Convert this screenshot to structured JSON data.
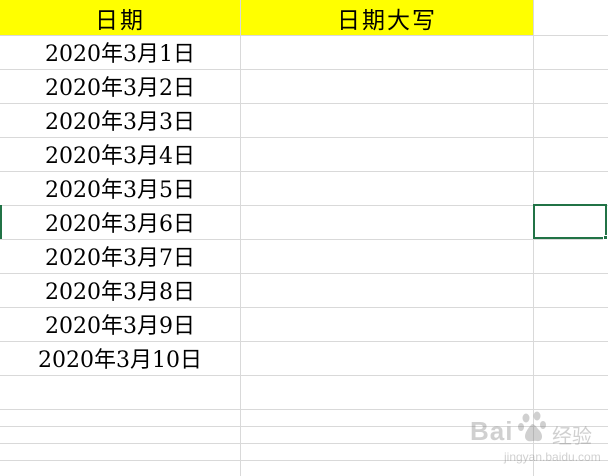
{
  "sheet": {
    "headers": {
      "date": "日期",
      "date_upper": "日期大写"
    },
    "header_color": "#ffff00",
    "selection_color": "#217346",
    "rows": [
      "2020年3月1日",
      "2020年3月2日",
      "2020年3月3日",
      "2020年3月4日",
      "2020年3月5日",
      "2020年3月6日",
      "2020年3月7日",
      "2020年3月8日",
      "2020年3月9日",
      "2020年3月10日"
    ]
  },
  "watermark": {
    "brand": "Bai",
    "brand_cn": "经验",
    "url": "jingyan.baidu.com",
    "icon": "baidu-paw-icon"
  }
}
